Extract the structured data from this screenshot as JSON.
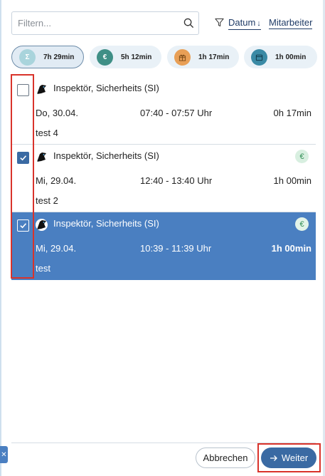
{
  "filter": {
    "search_placeholder": "Filtern...",
    "sort_date_label": "Datum",
    "sort_date_arrow": "↓",
    "sort_employee_label": "Mitarbeiter"
  },
  "summary": [
    {
      "icon": "sigma-icon",
      "symbol": "Σ",
      "value": "7h 29min",
      "color": "#a9d4dc",
      "active": true
    },
    {
      "icon": "euro-icon",
      "symbol": "€",
      "value": "5h 12min",
      "color": "#3f8f86",
      "active": false
    },
    {
      "icon": "gift-icon",
      "symbol": "",
      "value": "1h 17min",
      "color": "#e89f56",
      "active": false
    },
    {
      "icon": "calendar-icon",
      "symbol": "",
      "value": "1h 00min",
      "color": "#3a8aa5",
      "active": false
    }
  ],
  "entries": [
    {
      "name": "Inspektör, Sicherheits (SI)",
      "date": "Do, 30.04.",
      "time": "07:40 - 07:57 Uhr",
      "duration": "0h 17min",
      "note": "test 4",
      "checked": false,
      "billable": false
    },
    {
      "name": "Inspektör, Sicherheits (SI)",
      "date": "Mi, 29.04.",
      "time": "12:40 - 13:40 Uhr",
      "duration": "1h 00min",
      "note": "test 2",
      "checked": true,
      "billable": true,
      "billable_symbol": "€"
    },
    {
      "name": "Inspektör, Sicherheits (SI)",
      "date": "Mi, 29.04.",
      "time": "10:39 - 11:39 Uhr",
      "duration": "1h 00min",
      "note": "test",
      "checked": true,
      "billable": true,
      "billable_symbol": "€",
      "selected": true
    }
  ],
  "footer": {
    "cancel_label": "Abbrechen",
    "next_label": "Weiter",
    "side_tab_symbol": "✕"
  },
  "colors": {
    "accent": "#3a6aa3",
    "selected_row": "#4a7fc1",
    "annotation": "#d9332b"
  }
}
